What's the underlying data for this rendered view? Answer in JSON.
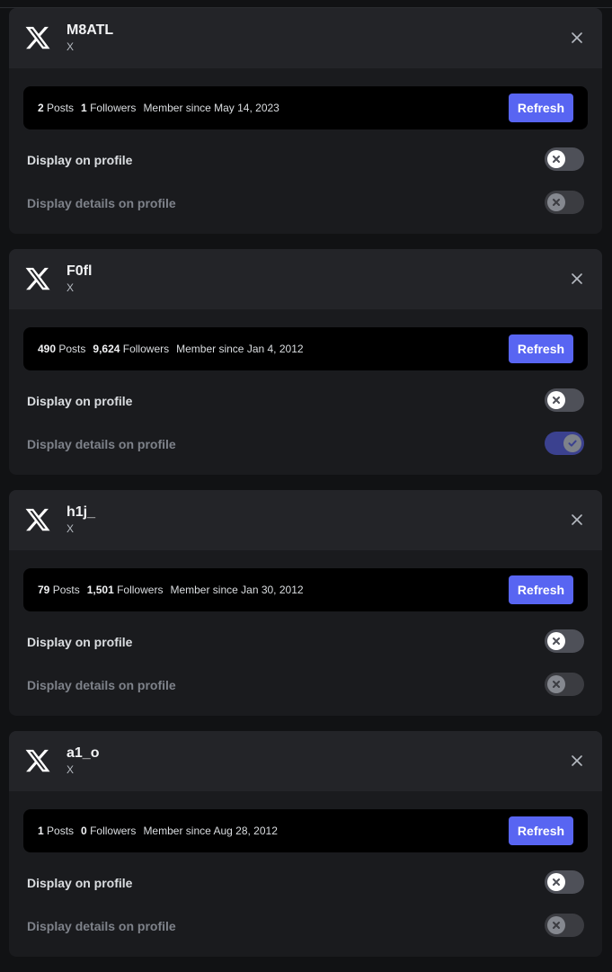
{
  "accounts": [
    {
      "username": "M8ATL",
      "platform": "X",
      "posts": "2",
      "posts_label": "Posts",
      "followers": "1",
      "followers_label": "Followers",
      "member_since": "Member since May 14, 2023",
      "refresh_label": "Refresh",
      "display_on_profile_label": "Display on profile",
      "display_on_profile": false,
      "display_details_label": "Display details on profile",
      "display_details": false,
      "display_details_disabled": true
    },
    {
      "username": "F0fl",
      "platform": "X",
      "posts": "490",
      "posts_label": "Posts",
      "followers": "9,624",
      "followers_label": "Followers",
      "member_since": "Member since Jan 4, 2012",
      "refresh_label": "Refresh",
      "display_on_profile_label": "Display on profile",
      "display_on_profile": false,
      "display_details_label": "Display details on profile",
      "display_details": true,
      "display_details_disabled": true
    },
    {
      "username": "h1j_",
      "platform": "X",
      "posts": "79",
      "posts_label": "Posts",
      "followers": "1,501",
      "followers_label": "Followers",
      "member_since": "Member since Jan 30, 2012",
      "refresh_label": "Refresh",
      "display_on_profile_label": "Display on profile",
      "display_on_profile": false,
      "display_details_label": "Display details on profile",
      "display_details": false,
      "display_details_disabled": true
    },
    {
      "username": "a1_o",
      "platform": "X",
      "posts": "1",
      "posts_label": "Posts",
      "followers": "0",
      "followers_label": "Followers",
      "member_since": "Member since Aug 28, 2012",
      "refresh_label": "Refresh",
      "display_on_profile_label": "Display on profile",
      "display_on_profile": false,
      "display_details_label": "Display details on profile",
      "display_details": false,
      "display_details_disabled": true
    }
  ],
  "icons": {
    "logo": "x-logo-icon",
    "close": "close-icon",
    "toggle_off": "x-mark-icon",
    "toggle_on": "check-icon"
  },
  "colors": {
    "accent": "#5865f2",
    "card_background": "#1a1b1e",
    "header_background": "#232428",
    "stats_background": "#000000",
    "toggle_off": "#4e5058",
    "toggle_on": "#3b418f"
  }
}
